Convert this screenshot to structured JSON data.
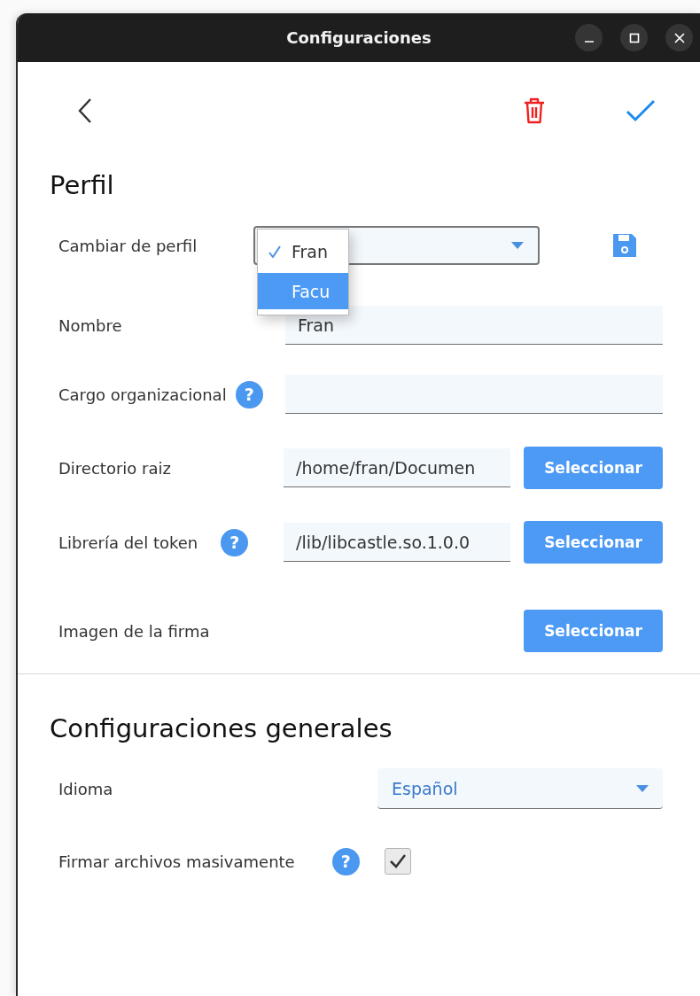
{
  "window": {
    "title": "Configuraciones"
  },
  "sections": [
    {
      "title": "Perfil",
      "rows": [
        {
          "kind": "profile",
          "label": "Cambiar de perfil",
          "options": [
            {
              "label": "Fran",
              "selected": true,
              "highlighted": false
            },
            {
              "label": "Facu",
              "selected": false,
              "highlighted": true
            }
          ]
        },
        {
          "kind": "text",
          "label": "Nombre",
          "value": "Fran"
        },
        {
          "kind": "text",
          "label": "Cargo organizacional",
          "help": "?"
        },
        {
          "kind": "path",
          "label": "Directorio raiz",
          "value": "/home/fran/Documen",
          "button": "Seleccionar"
        },
        {
          "kind": "path",
          "label": "Librería del token",
          "help": "?",
          "value": "/lib/libcastle.so.1.0.0",
          "button": "Seleccionar"
        },
        {
          "kind": "file",
          "label": "Imagen de la firma",
          "button": "Seleccionar"
        }
      ]
    },
    {
      "title": "Configuraciones generales",
      "rows": [
        {
          "kind": "select",
          "label": "Idioma",
          "value": "Español"
        },
        {
          "kind": "checkbox",
          "label": "Firmar archivos masivamente",
          "help": "?",
          "checked": true
        }
      ]
    }
  ]
}
